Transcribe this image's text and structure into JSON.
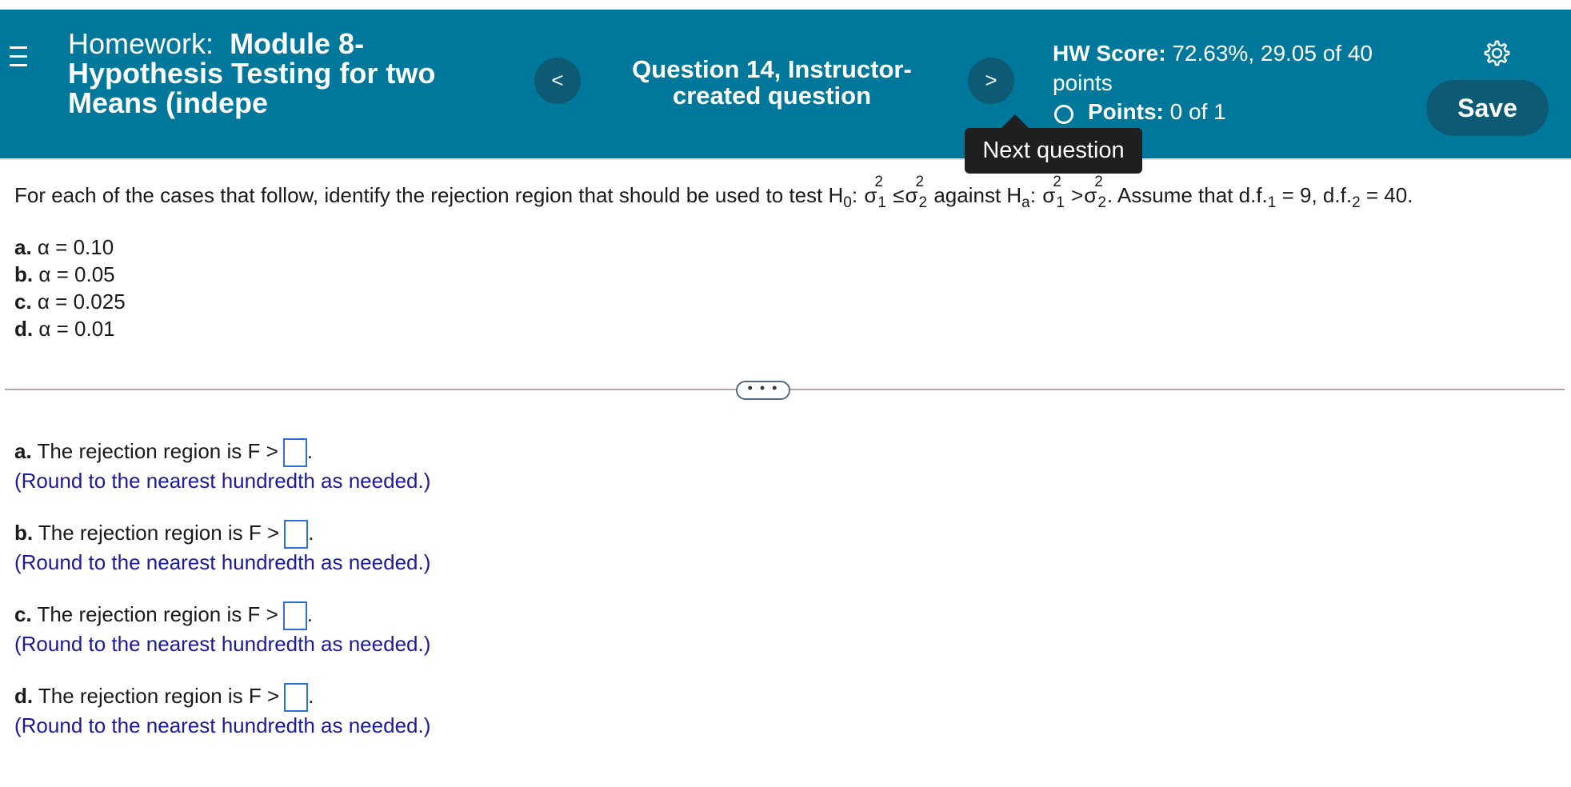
{
  "header": {
    "title_label": "Homework:",
    "title_name": "Module 8- Hypothesis Testing for two Means (indepe",
    "question_title": "Question 14, Instructor-created question",
    "prev_label": "<",
    "next_label": ">",
    "hw_score_label": "HW Score:",
    "hw_score_value": "72.63%, 29.05 of 40 points",
    "points_label": "Points:",
    "points_value": "0 of 1",
    "save_label": "Save",
    "tooltip": "Next question",
    "colors": {
      "header_bg": "#00789c",
      "button_bg": "#0d5a75"
    }
  },
  "question": {
    "intro": "For each of the cases that follow, identify the rejection region that should be used to test H",
    "h0_sub": "0",
    "against": "against H",
    "ha_sub": "a",
    "assume": ". Assume that d.f.",
    "df1_sub": "1",
    "df1_val": "= 9,",
    "df2_label": "d.f.",
    "df2_sub": "2",
    "df2_val": "= 40.",
    "sigma": "σ",
    "sq": "2",
    "one": "1",
    "two": "2",
    "le": "≤",
    "gt": ">",
    "colon": ":"
  },
  "cases": [
    {
      "letter": "a.",
      "text": "α = 0.10"
    },
    {
      "letter": "b.",
      "text": "α = 0.05"
    },
    {
      "letter": "c.",
      "text": "α = 0.025"
    },
    {
      "letter": "d.",
      "text": "α = 0.01"
    }
  ],
  "expander": "• • •",
  "answers": [
    {
      "letter": "a.",
      "text": "The rejection region is F >",
      "value": "",
      "period": ".",
      "hint": "(Round to the nearest hundredth as needed.)"
    },
    {
      "letter": "b.",
      "text": "The rejection region is F >",
      "value": "",
      "period": ".",
      "hint": "(Round to the nearest hundredth as needed.)"
    },
    {
      "letter": "c.",
      "text": "The rejection region is F >",
      "value": "",
      "period": ".",
      "hint": "(Round to the nearest hundredth as needed.)"
    },
    {
      "letter": "d.",
      "text": "The rejection region is F >",
      "value": "",
      "period": ".",
      "hint": "(Round to the nearest hundredth as needed.)"
    }
  ]
}
